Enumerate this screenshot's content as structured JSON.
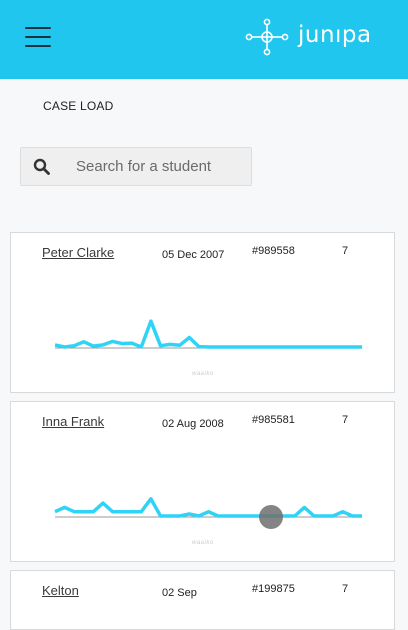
{
  "header": {
    "brand": "junıpa",
    "menu_icon": "hamburger-icon",
    "logo_icon": "network-nodes-icon",
    "background": "#20c6ee"
  },
  "page": {
    "section_title": "CASE LOAD"
  },
  "search": {
    "placeholder": "Search for a student",
    "value": "",
    "icon": "search-icon"
  },
  "students": [
    {
      "name": "Peter Clarke",
      "dob": "05 Dec 2007",
      "id": "#989558",
      "grade": "7",
      "watermark": "waaiko",
      "trend": [
        0.5,
        0,
        0.3,
        1.2,
        0.2,
        0.5,
        1.3,
        0.8,
        0.9,
        0,
        6,
        0.3,
        0.6,
        0.4,
        2.2,
        0.1,
        0,
        0,
        0,
        0,
        0,
        0,
        0,
        0,
        0,
        0,
        0,
        0,
        0,
        0,
        0,
        0,
        0
      ]
    },
    {
      "name": "Inna Frank",
      "dob": "02 Aug 2008",
      "id": "#985581",
      "grade": "7",
      "watermark": "waaiko",
      "trend": [
        1,
        2,
        1,
        1,
        1,
        3,
        1,
        1,
        1,
        1,
        4,
        0,
        0,
        0,
        0.5,
        0,
        1,
        0,
        0,
        0,
        0,
        0,
        0,
        0,
        0,
        0,
        2,
        0,
        0,
        0,
        1,
        0,
        0
      ]
    },
    {
      "name": "Kelton",
      "dob": "02 Sep",
      "id": "#199875",
      "grade": "7"
    }
  ],
  "colors": {
    "sparkline": "#2fd3f7",
    "baseline": "#9a9a9a"
  }
}
